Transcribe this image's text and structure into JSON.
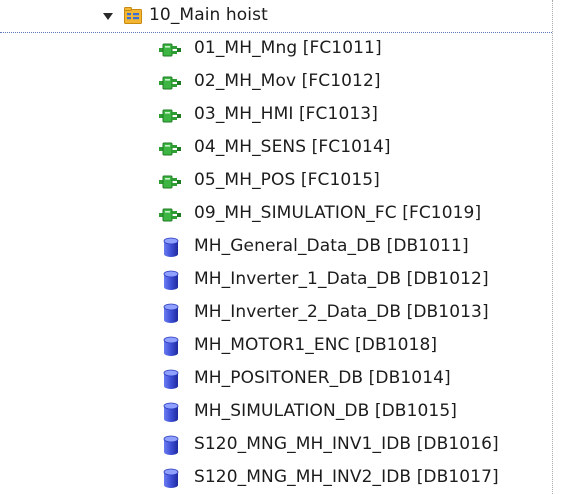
{
  "folder": {
    "label": "10_Main hoist",
    "expanded": true,
    "icon": "program-folder-icon"
  },
  "items": [
    {
      "label": "01_MH_Mng [FC1011]",
      "type": "FC",
      "icon": "function-block-icon"
    },
    {
      "label": "02_MH_Mov [FC1012]",
      "type": "FC",
      "icon": "function-block-icon"
    },
    {
      "label": "03_MH_HMI [FC1013]",
      "type": "FC",
      "icon": "function-block-icon"
    },
    {
      "label": "04_MH_SENS [FC1014]",
      "type": "FC",
      "icon": "function-block-icon"
    },
    {
      "label": "05_MH_POS [FC1015]",
      "type": "FC",
      "icon": "function-block-icon"
    },
    {
      "label": "09_MH_SIMULATION_FC [FC1019]",
      "type": "FC",
      "icon": "function-block-icon"
    },
    {
      "label": "MH_General_Data_DB [DB1011]",
      "type": "DB",
      "icon": "data-block-icon"
    },
    {
      "label": "MH_Inverter_1_Data_DB [DB1012]",
      "type": "DB",
      "icon": "data-block-icon"
    },
    {
      "label": "MH_Inverter_2_Data_DB [DB1013]",
      "type": "DB",
      "icon": "data-block-icon"
    },
    {
      "label": "MH_MOTOR1_ENC [DB1018]",
      "type": "DB",
      "icon": "data-block-icon"
    },
    {
      "label": "MH_POSITONER_DB [DB1014]",
      "type": "DB",
      "icon": "data-block-icon"
    },
    {
      "label": "MH_SIMULATION_DB [DB1015]",
      "type": "DB",
      "icon": "data-block-icon"
    },
    {
      "label": "S120_MNG_MH_INV1_IDB [DB1016]",
      "type": "DB",
      "icon": "data-block-icon"
    },
    {
      "label": "S120_MNG_MH_INV2_IDB [DB1017]",
      "type": "DB",
      "icon": "data-block-icon"
    }
  ],
  "colors": {
    "fc_icon": "#2e9e32",
    "db_icon": "#3d4fd6",
    "folder_icon": "#e8a317",
    "text": "#1c1c1c"
  }
}
